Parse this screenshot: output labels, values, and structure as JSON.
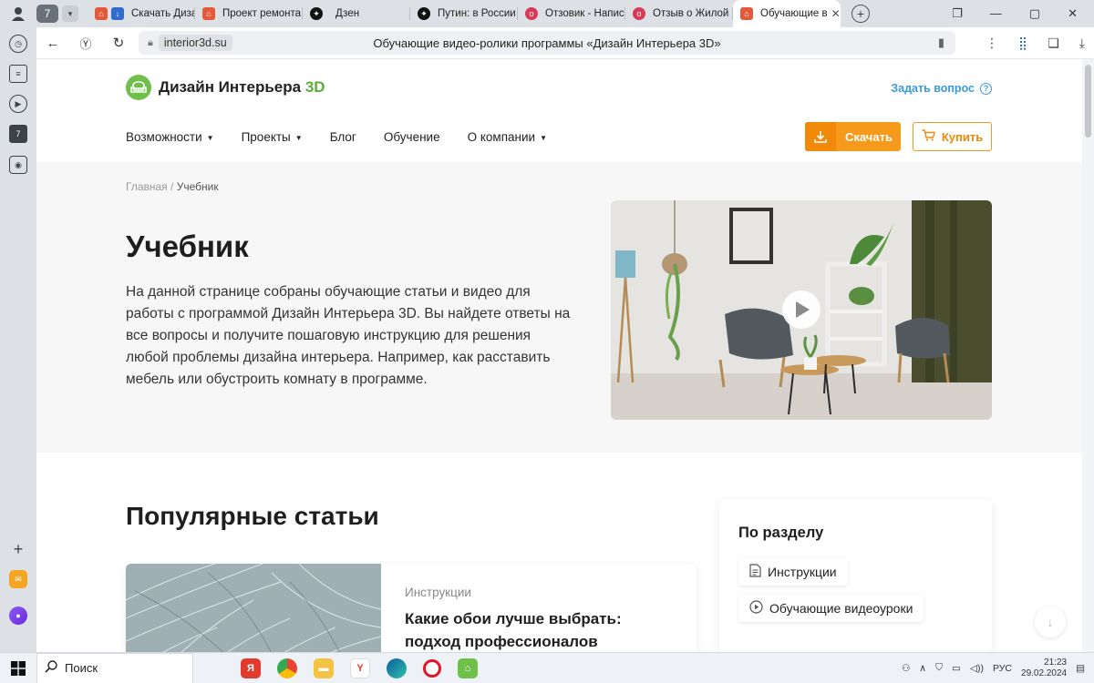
{
  "browser": {
    "tab_count": "7",
    "tabs": [
      {
        "label": "Скачать Диза",
        "color": "#2f6ccd"
      },
      {
        "label": "Проект ремонта",
        "color": "#e25a3b"
      },
      {
        "label": "Дзен",
        "color": "#111111"
      },
      {
        "label": "Путин: в России",
        "color": "#111111"
      },
      {
        "label": "Отзовик - Напис",
        "color": "#d63a57"
      },
      {
        "label": "Отзыв о Жилой",
        "color": "#d63a57"
      },
      {
        "label": "Обучающие в",
        "color": "#e25a3b"
      }
    ],
    "domain": "interior3d.su",
    "page_title": "Обучающие видео-ролики программы «Дизайн Интерьера 3D»"
  },
  "header": {
    "logo_text": "Дизайн Интерьера",
    "logo_accent": "3D",
    "ask_label": "Задать вопрос",
    "nav": [
      {
        "label": "Возможности",
        "dropdown": true
      },
      {
        "label": "Проекты",
        "dropdown": true
      },
      {
        "label": "Блог",
        "dropdown": false
      },
      {
        "label": "Обучение",
        "dropdown": false
      },
      {
        "label": "О компании",
        "dropdown": true
      }
    ],
    "download_label": "Скачать",
    "buy_label": "Купить"
  },
  "hero": {
    "breadcrumb_home": "Главная",
    "breadcrumb_sep": "/",
    "breadcrumb_current": "Учебник",
    "title": "Учебник",
    "description": "На данной странице собраны обучающие статьи и видео для работы с программой Дизайн Интерьера 3D. Вы найдете ответы на все вопросы и получите пошаговую инструкцию для решения любой проблемы дизайна интерьера. Например, как расставить мебель или обустроить комнату в программе."
  },
  "popular": {
    "title": "Популярные статьи",
    "article_category": "Инструкции",
    "article_title": "Какие обои лучше выбрать: подход профессионалов"
  },
  "sidebar_card": {
    "title": "По разделу",
    "items": [
      {
        "label": "Инструкции",
        "icon": "document-icon"
      },
      {
        "label": "Обучающие видеоуроки",
        "icon": "play-icon"
      }
    ]
  },
  "taskbar": {
    "search_label": "Поиск",
    "lang": "РУС",
    "time": "21:23",
    "date": "29.02.2024"
  },
  "colors": {
    "accent_orange": "#f59a1a",
    "brand_green": "#5cae3a",
    "link_blue": "#3a9ad9"
  }
}
